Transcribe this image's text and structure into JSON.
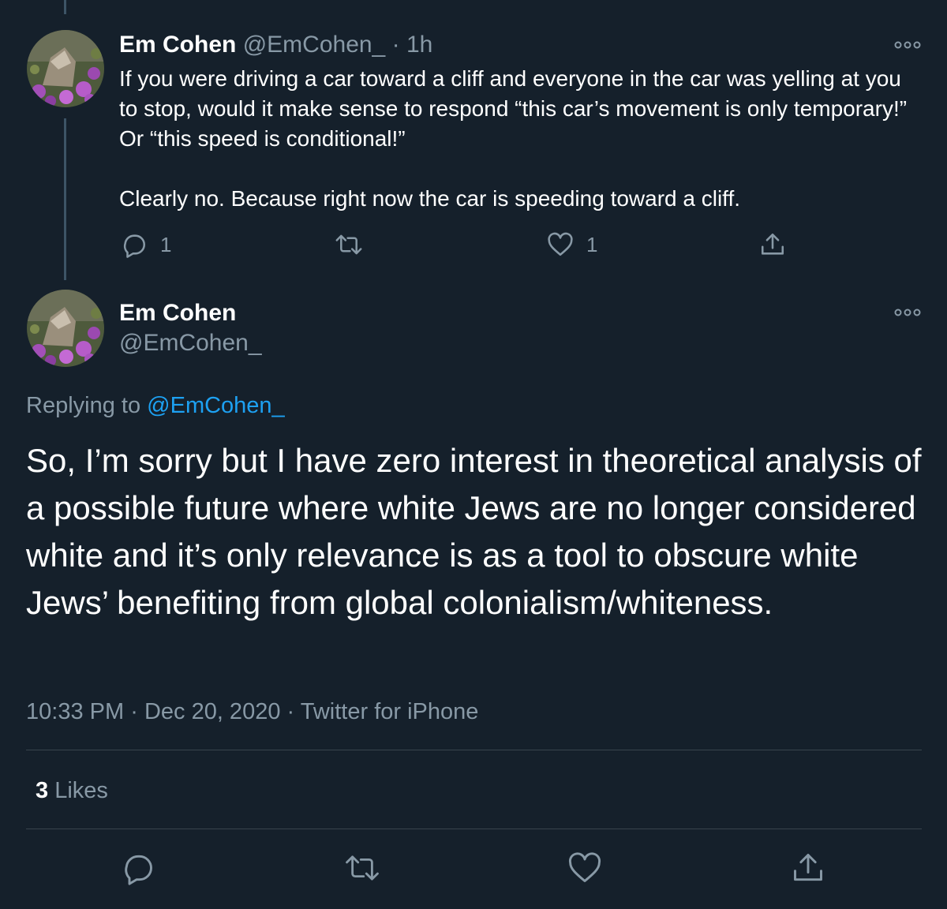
{
  "tweet1": {
    "name": "Em Cohen",
    "handle": "@EmCohen_",
    "separator": "·",
    "time": "1h",
    "line1": "If you were driving a car toward a cliff and everyone in the car was yelling at you to stop, would it make sense to respond “this car’s movement is only temporary!” Or “this speed is conditional!”",
    "line2": "Clearly no. Because right now the car is speeding toward a cliff.",
    "reply_count": "1",
    "like_count": "1",
    "icons": [
      "reply-icon",
      "retweet-icon",
      "like-icon",
      "share-icon",
      "more-icon"
    ]
  },
  "tweet2": {
    "name": "Em Cohen",
    "handle": "@EmCohen_",
    "replying_prefix": "Replying to",
    "replying_to": "@EmCohen_",
    "text": "So, I’m sorry but I have zero interest in theoretical analysis of a possible future where white Jews are no longer considered white and it’s only relevance is as a tool to obscure white Jews’ benefiting from global colonialism/whiteness.",
    "time": "10:33 PM",
    "sep1": "·",
    "date": "Dec 20, 2020",
    "sep2": "·",
    "source": "Twitter for iPhone",
    "likes_count": "3",
    "likes_label": "Likes"
  },
  "colors": {
    "background": "#15202b",
    "text": "#ffffff",
    "muted": "#8899a6",
    "link": "#1da1f2",
    "divider": "#38444d"
  }
}
